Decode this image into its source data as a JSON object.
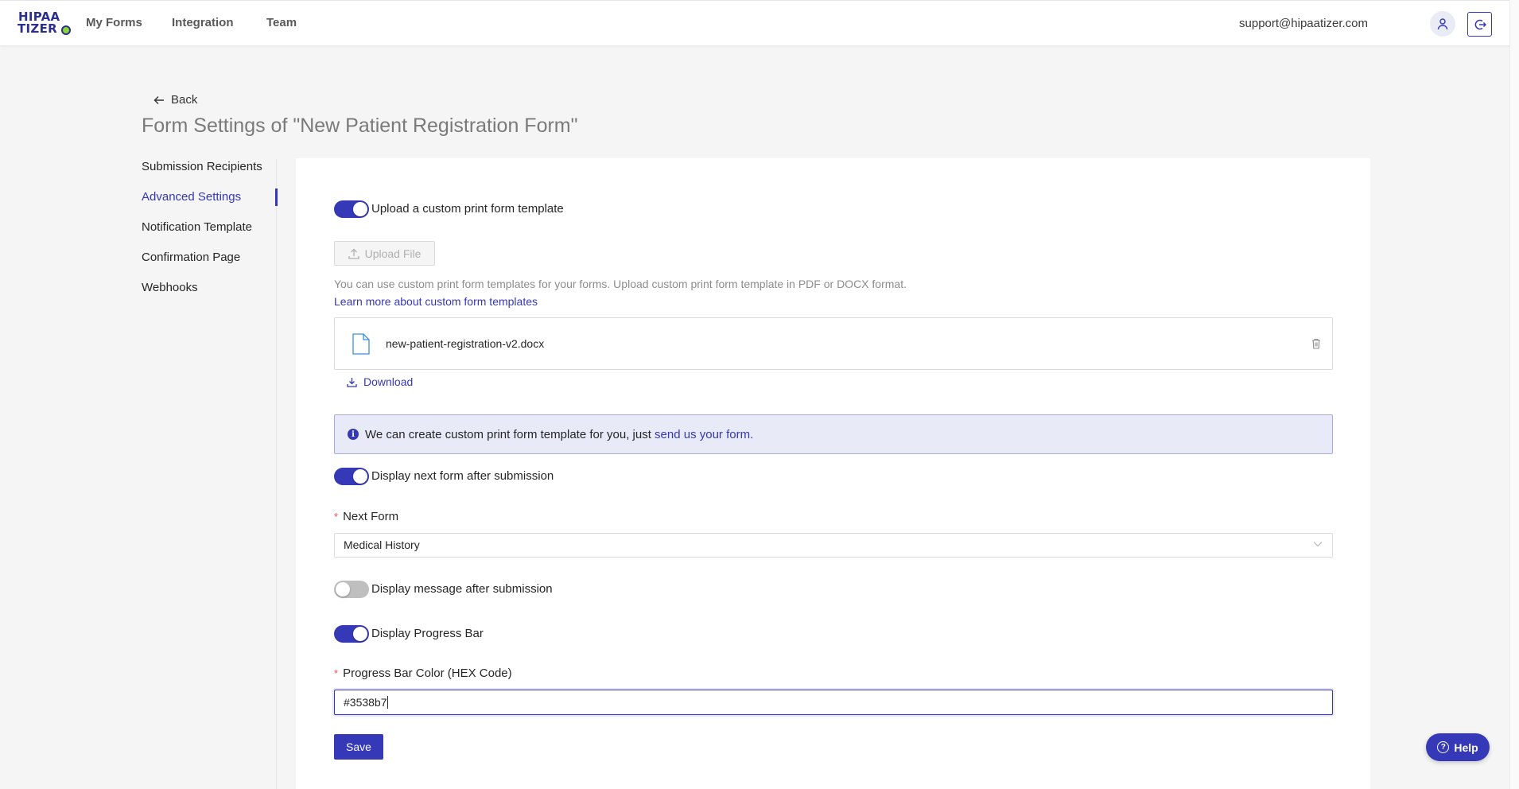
{
  "header": {
    "logo_line1": "HIPAA",
    "logo_line2": "TIZER",
    "nav": [
      "My Forms",
      "Integration",
      "Team"
    ],
    "email": "support@hipaatizer.com"
  },
  "page": {
    "back_label": "Back",
    "title": "Form Settings of \"New Patient Registration Form\""
  },
  "sidebar": {
    "items": [
      {
        "label": "Submission Recipients"
      },
      {
        "label": "Advanced Settings"
      },
      {
        "label": "Notification Template"
      },
      {
        "label": "Confirmation Page"
      },
      {
        "label": "Webhooks"
      }
    ],
    "active_index": 1
  },
  "settings": {
    "custom_template": {
      "label": "Upload a custom print form template",
      "enabled": true,
      "upload_label": "Upload File",
      "help_text": "You can use custom print form templates for your forms. Upload custom print form template in PDF or DOCX format.",
      "learn_more": "Learn more about custom form templates",
      "file_name": "new-patient-registration-v2.docx",
      "download_label": "Download",
      "info_text": "We can create custom print form template for you, just ",
      "info_link": "send us your form."
    },
    "next_form": {
      "toggle_label": "Display next form after submission",
      "enabled": true,
      "field_label": "Next Form",
      "required_mark": "*",
      "value": "Medical History"
    },
    "message_after": {
      "toggle_label": "Display message after submission",
      "enabled": false
    },
    "progress_bar": {
      "toggle_label": "Display Progress Bar",
      "enabled": true,
      "color_label": "Progress Bar Color (HEX Code)",
      "required_mark": "*",
      "color_value": "#3538b7"
    },
    "save_label": "Save"
  },
  "help_button": "Help",
  "colors": {
    "accent": "#3538b7",
    "info_bg": "#e8eaf7",
    "logo_green": "#8bd53a"
  }
}
